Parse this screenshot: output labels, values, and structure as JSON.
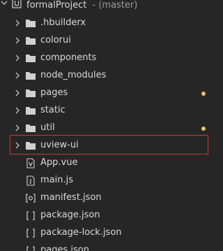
{
  "project": {
    "name": "formalProject",
    "branch": " - (master)"
  },
  "tree": {
    "items": [
      {
        "label": ".hbuilderx",
        "type": "folder",
        "modified": false
      },
      {
        "label": "colorui",
        "type": "folder",
        "modified": false
      },
      {
        "label": "components",
        "type": "folder",
        "modified": false
      },
      {
        "label": "node_modules",
        "type": "folder",
        "modified": false
      },
      {
        "label": "pages",
        "type": "folder",
        "modified": true
      },
      {
        "label": "static",
        "type": "folder",
        "modified": false
      },
      {
        "label": "util",
        "type": "folder",
        "modified": true
      },
      {
        "label": "uview-ui",
        "type": "folder",
        "modified": false,
        "highlighted": true
      },
      {
        "label": "App.vue",
        "type": "vue-file",
        "modified": false
      },
      {
        "label": "main.js",
        "type": "js-file",
        "modified": false
      },
      {
        "label": "manifest.json",
        "type": "manifest-file",
        "modified": false
      },
      {
        "label": "package.json",
        "type": "json-file",
        "modified": false
      },
      {
        "label": "package-lock.json",
        "type": "json-file",
        "modified": false
      },
      {
        "label": "pages.json",
        "type": "json-file",
        "modified": false
      }
    ]
  },
  "colors": {
    "background": "#262626",
    "text": "#d9d9d9",
    "modified_dot": "#e6c36a",
    "highlight_border": "#c23a3a"
  }
}
